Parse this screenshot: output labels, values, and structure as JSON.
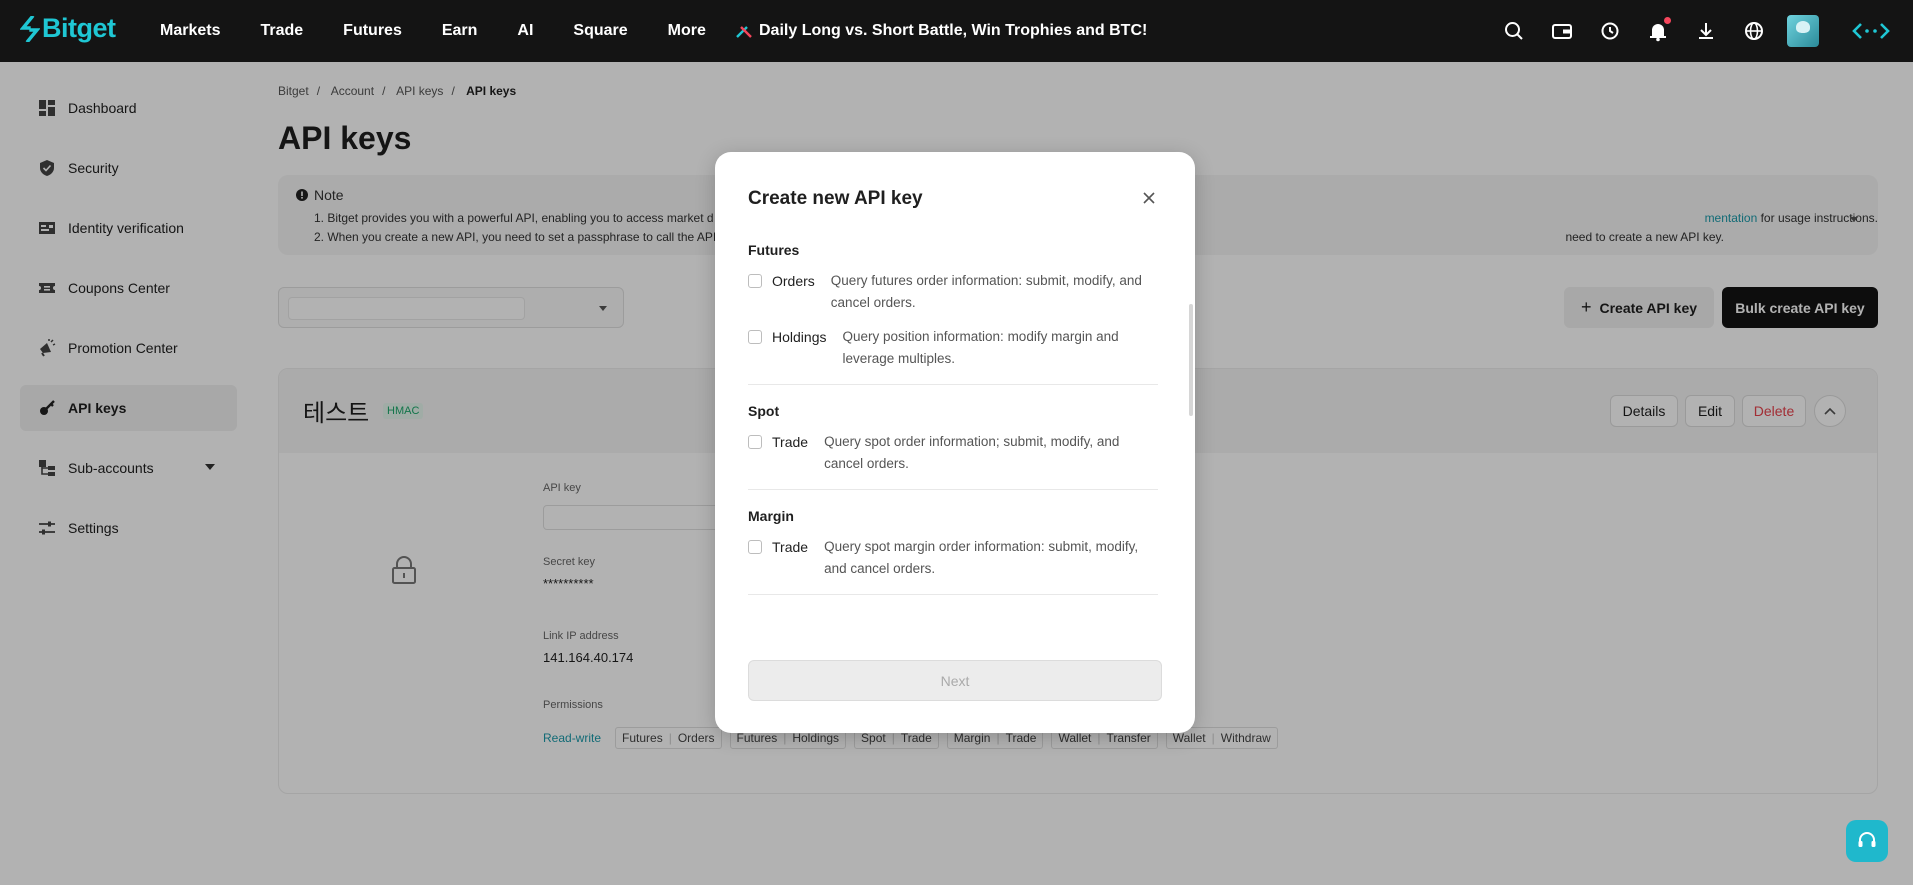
{
  "brand": {
    "name": "Bitget",
    "accent": "#1fc7d4"
  },
  "nav": [
    "Markets",
    "Trade",
    "Futures",
    "Earn",
    "AI",
    "Square",
    "More"
  ],
  "promo": "Daily Long vs. Short Battle, Win Trophies and BTC!",
  "top_icons": [
    "search-icon",
    "wallet-icon",
    "history-icon",
    "bell-icon",
    "download-icon",
    "globe-icon",
    "avatar",
    "code-icon"
  ],
  "sidebar": {
    "items": [
      {
        "label": "Dashboard",
        "icon": "grid-icon"
      },
      {
        "label": "Security",
        "icon": "shield-icon"
      },
      {
        "label": "Identity verification",
        "icon": "id-card-icon"
      },
      {
        "label": "Coupons Center",
        "icon": "ticket-icon"
      },
      {
        "label": "Promotion Center",
        "icon": "megaphone-icon"
      },
      {
        "label": "API keys",
        "icon": "key-icon",
        "active": true
      },
      {
        "label": "Sub-accounts",
        "icon": "sub-accounts-icon"
      },
      {
        "label": "Settings",
        "icon": "sliders-icon"
      }
    ]
  },
  "breadcrumb": [
    "Bitget",
    "Account",
    "API keys",
    "API keys"
  ],
  "page_title": "API keys",
  "note": {
    "heading": "Note",
    "line1": "1.  Bitget provides you with a powerful API, enabling you to access market d",
    "line1_right_link": "mentation",
    "line1_right": " for usage instructions.",
    "line2": "2.  When you create a new API, you need to set a passphrase to call the API",
    "line2_right": "need to create a new API key."
  },
  "actions": {
    "create": "Create API key",
    "bulk": "Bulk create API key"
  },
  "card": {
    "name": "테스트",
    "badge": "HMAC",
    "buttons": {
      "details": "Details",
      "edit": "Edit",
      "delete": "Delete"
    },
    "api_key_label": "API key",
    "secret_label": "Secret key",
    "secret_value": "**********",
    "ip_label": "Link IP address",
    "ip_value": "141.164.40.174",
    "perm_label": "Permissions",
    "perm_mode": "Read-write",
    "perm_tags": [
      {
        "a": "Futures",
        "b": "Orders"
      },
      {
        "a": "Futures",
        "b": "Holdings"
      },
      {
        "a": "Spot",
        "b": "Trade"
      },
      {
        "a": "Margin",
        "b": "Trade"
      },
      {
        "a": "Wallet",
        "b": "Transfer"
      },
      {
        "a": "Wallet",
        "b": "Withdraw"
      }
    ]
  },
  "modal": {
    "title": "Create new API key",
    "sections": [
      {
        "title": "Futures",
        "perms": [
          {
            "name": "Orders",
            "desc": "Query futures order information: submit, modify, and cancel orders."
          },
          {
            "name": "Holdings",
            "desc": "Query position information: modify margin and leverage multiples."
          }
        ]
      },
      {
        "title": "Spot",
        "perms": [
          {
            "name": "Trade",
            "desc": "Query spot order information; submit, modify, and cancel orders."
          }
        ]
      },
      {
        "title": "Margin",
        "perms": [
          {
            "name": "Trade",
            "desc": "Query spot margin order information: submit, modify, and cancel orders."
          }
        ]
      }
    ],
    "next": "Next"
  }
}
